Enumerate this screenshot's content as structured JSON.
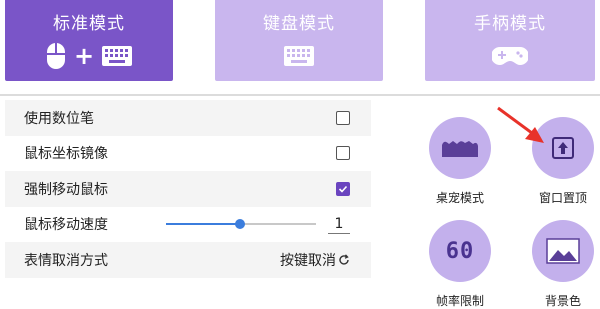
{
  "modes": [
    {
      "label": "标准模式",
      "active": true
    },
    {
      "label": "键盘模式",
      "active": false
    },
    {
      "label": "手柄模式",
      "active": false
    }
  ],
  "settings": {
    "digital_pen": {
      "label": "使用数位笔",
      "checked": false
    },
    "mirror_coords": {
      "label": "鼠标坐标镜像",
      "checked": false
    },
    "force_move_mouse": {
      "label": "强制移动鼠标",
      "checked": true
    },
    "move_speed": {
      "label": "鼠标移动速度",
      "value": "1",
      "level": 0.49
    },
    "expression_cancel": {
      "label": "表情取消方式",
      "value": "按键取消"
    }
  },
  "features": {
    "pet_mode": "桌宠模式",
    "window_top": "窗口置顶",
    "frame_limit": "帧率限制",
    "frame_limit_value": "60",
    "background_color": "背景色"
  },
  "colors": {
    "accent": "#7a55c8",
    "tab_inactive": "#c9b6ee",
    "feature_circle": "#c3b0ec",
    "arrow_annotation": "#e8322a",
    "slider": "#3b7ddd"
  }
}
